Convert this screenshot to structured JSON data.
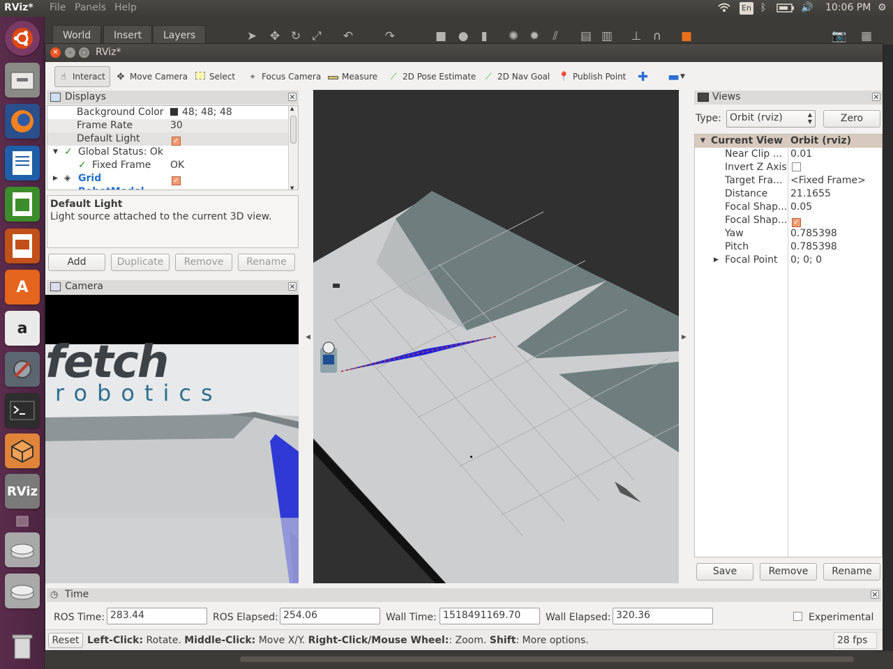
{
  "topbar": {
    "app": "RViz*",
    "menus": [
      "File",
      "Panels",
      "Help"
    ],
    "lang": "En",
    "clock": "10:06 PM"
  },
  "background_window": {
    "tabs": [
      "World",
      "Insert",
      "Layers"
    ]
  },
  "window": {
    "title": "RViz*"
  },
  "toolbar": {
    "tools": [
      "Interact",
      "Move Camera",
      "Select",
      "Focus Camera",
      "Measure",
      "2D Pose Estimate",
      "2D Nav Goal",
      "Publish Point"
    ]
  },
  "displays": {
    "title": "Displays",
    "rows": [
      {
        "key": "Background Color",
        "value": "48; 48; 48"
      },
      {
        "key": "Frame Rate",
        "value": "30"
      },
      {
        "key": "Default Light",
        "value": ""
      },
      {
        "key": "Global Status: Ok",
        "value": ""
      },
      {
        "key": "Fixed Frame",
        "value": "OK"
      },
      {
        "key": "Grid",
        "value": ""
      },
      {
        "key": "RobotModel",
        "value": ""
      }
    ],
    "desc_title": "Default Light",
    "desc_text": "Light source attached to the current 3D view.",
    "buttons": [
      "Add",
      "Duplicate",
      "Remove",
      "Rename"
    ]
  },
  "camera": {
    "title": "Camera",
    "logo_main": "fetch",
    "logo_sub": "robotics"
  },
  "views": {
    "title": "Views",
    "type_label": "Type:",
    "type_value": "Orbit (rviz)",
    "zero_label": "Zero",
    "header_key": "Current View",
    "header_value": "Orbit (rviz)",
    "rows": [
      {
        "key": "Near Clip ...",
        "value": "0.01"
      },
      {
        "key": "Invert Z Axis",
        "value": ""
      },
      {
        "key": "Target Fra...",
        "value": "<Fixed Frame>"
      },
      {
        "key": "Distance",
        "value": "21.1655"
      },
      {
        "key": "Focal Shap...",
        "value": "0.05"
      },
      {
        "key": "Focal Shap...",
        "value": ""
      },
      {
        "key": "Yaw",
        "value": "0.785398"
      },
      {
        "key": "Pitch",
        "value": "0.785398"
      },
      {
        "key": "Focal Point",
        "value": "0; 0; 0"
      }
    ],
    "buttons": [
      "Save",
      "Remove",
      "Rename"
    ]
  },
  "time": {
    "title": "Time",
    "ros_time_label": "ROS Time:",
    "ros_time": "283.44",
    "ros_elapsed_label": "ROS Elapsed:",
    "ros_elapsed": "254.06",
    "wall_time_label": "Wall Time:",
    "wall_time": "1518491169.70",
    "wall_elapsed_label": "Wall Elapsed:",
    "wall_elapsed": "320.36",
    "experimental_label": "Experimental"
  },
  "status": {
    "reset_label": "Reset",
    "hint_b1": "Left-Click:",
    "hint_t1": " Rotate. ",
    "hint_b2": "Middle-Click:",
    "hint_t2": " Move X/Y. ",
    "hint_b3": "Right-Click/Mouse Wheel:",
    "hint_t3": ": Zoom. ",
    "hint_b4": "Shift",
    "hint_t4": ": More options.",
    "fps": "28 fps"
  }
}
